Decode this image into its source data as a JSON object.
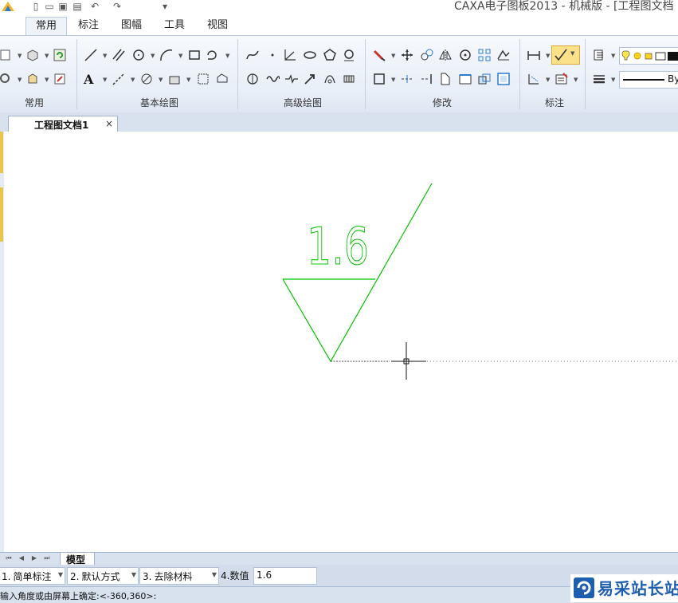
{
  "window": {
    "title": "CAXA电子图板2013 - 机械版 - [工程图文档"
  },
  "ribbon": {
    "tabs": [
      "常用",
      "标注",
      "图幅",
      "工具",
      "视图"
    ],
    "active_tab": "常用",
    "groups": [
      "常用",
      "基本绘图",
      "高级绘图",
      "修改",
      "标注"
    ],
    "text_tool": "A",
    "linetype_value": "By"
  },
  "document": {
    "tab_label": "工程图文档1",
    "close": "×"
  },
  "drawing": {
    "roughness_value": "1.6",
    "stroke_color": "#00c400"
  },
  "model_tabs": {
    "active": "模型"
  },
  "property_bar": {
    "items": [
      {
        "index": "1.",
        "value": "简单标注"
      },
      {
        "index": "2.",
        "value": "默认方式"
      },
      {
        "index": "3.",
        "value": "去除材料"
      },
      {
        "index": "4.数值",
        "value": "1.6"
      }
    ]
  },
  "status": {
    "prompt": "输入角度或由屏幕上确定:<-360,360>:"
  },
  "watermark": {
    "text": "易采站长站"
  }
}
